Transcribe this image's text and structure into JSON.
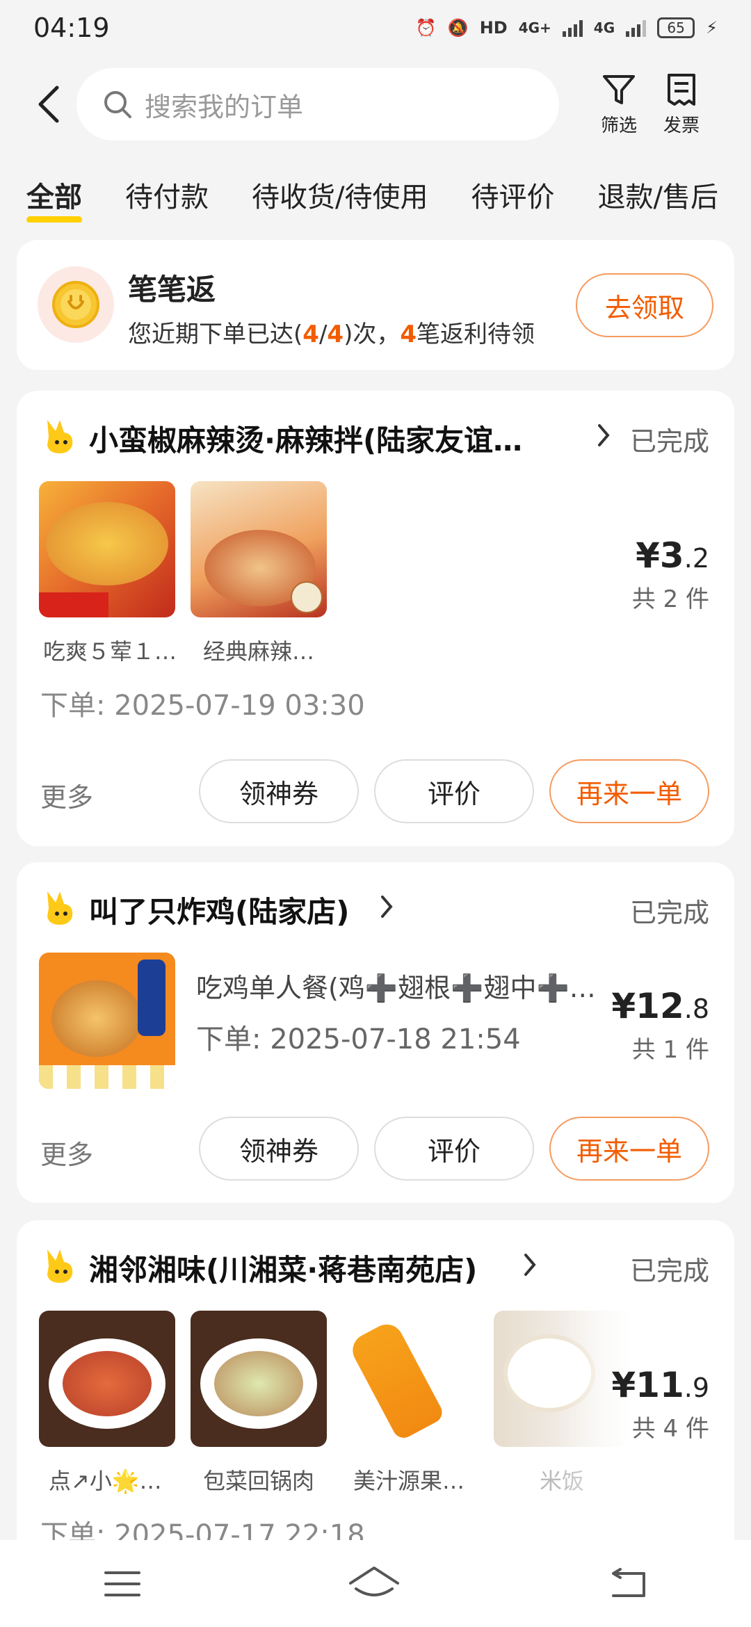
{
  "status_bar": {
    "time": "04:19",
    "battery": "65",
    "net1": "4G+",
    "net2": "4G"
  },
  "header": {
    "search_placeholder": "搜索我的订单",
    "filter_label": "筛选",
    "invoice_label": "发票"
  },
  "tabs": [
    "全部",
    "待付款",
    "待收货/待使用",
    "待评价",
    "退款/售后"
  ],
  "rebate": {
    "title": "笔笔返",
    "desc_prefix": "您近期下单已达(",
    "count_done": "4",
    "sep": "/",
    "count_total": "4",
    "desc_mid": ")次，",
    "pending": "4",
    "desc_suffix": "笔返利待领",
    "button": "去领取"
  },
  "orders": [
    {
      "shop": "小蛮椒麻辣烫·麻辣拌(陆家友谊…",
      "status": "已完成",
      "items": [
        "吃爽５荤１…",
        "经典麻辣…"
      ],
      "price_int": "¥3",
      "price_dec": ".2",
      "count": "共 2 件",
      "time": "下单: 2025-07-19 03:30",
      "more": "更多",
      "buttons": [
        "领神券",
        "评价",
        "再来一单"
      ]
    },
    {
      "shop": "叫了只炸鸡(陆家店)",
      "status": "已完成",
      "item_name": "吃鸡单人餐(鸡➕翅根➕翅中➕…",
      "price_int": "¥12",
      "price_dec": ".8",
      "count": "共 1 件",
      "time": "下单: 2025-07-18 21:54",
      "more": "更多",
      "buttons": [
        "领神券",
        "评价",
        "再来一单"
      ]
    },
    {
      "shop": "湘邻湘味(川湘菜·蒋巷南苑店)",
      "status": "已完成",
      "items": [
        "点↗小🌟…",
        "包菜回锅肉",
        "美汁源果…",
        "米饭"
      ],
      "price_int": "¥11",
      "price_dec": ".9",
      "count": "共 4 件",
      "time": "下单: 2025-07-17 22:18"
    }
  ],
  "colors": {
    "accent": "#f25c00",
    "tab_underline": "#ffd100"
  }
}
